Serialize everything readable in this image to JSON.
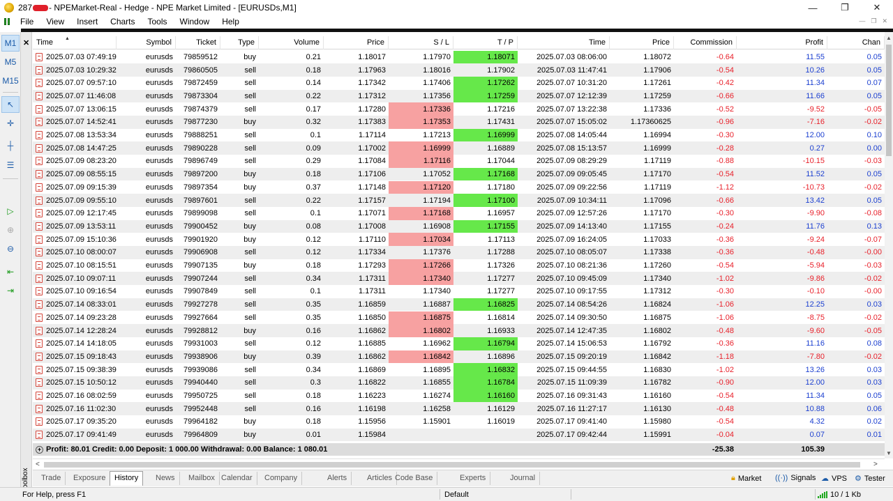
{
  "window": {
    "title_prefix": "287",
    "title_rest": "- NPEMarket-Real - Hedge - NPE Market Limited - [EURUSDs,M1]",
    "minimize": "—",
    "restore": "❐",
    "close": "✕"
  },
  "menu": [
    "File",
    "View",
    "Insert",
    "Charts",
    "Tools",
    "Window",
    "Help"
  ],
  "timeframes": [
    "M1",
    "M5",
    "M15"
  ],
  "toolbox_label": "Toolbox",
  "columns": [
    "Time",
    "Symbol",
    "Ticket",
    "Type",
    "Volume",
    "Price",
    "S / L",
    "T / P",
    "Time",
    "Price",
    "Commission",
    "Profit",
    "Chan"
  ],
  "rows": [
    [
      "2025.07.03 07:49:19",
      "eurusds",
      "79859512",
      "buy",
      "0.21",
      "1.18017",
      "1.17970",
      "1.18071",
      "2025.07.03 08:06:00",
      "1.18072",
      "-0.64",
      "11.55",
      "0.05",
      "tp"
    ],
    [
      "2025.07.03 10:29:32",
      "eurusds",
      "79860505",
      "sell",
      "0.18",
      "1.17963",
      "1.18016",
      "1.17902",
      "2025.07.03 11:47:41",
      "1.17906",
      "-0.54",
      "10.26",
      "0.05",
      ""
    ],
    [
      "2025.07.07 09:57:10",
      "eurusds",
      "79872459",
      "sell",
      "0.14",
      "1.17342",
      "1.17406",
      "1.17262",
      "2025.07.07 10:31:20",
      "1.17261",
      "-0.42",
      "11.34",
      "0.07",
      "tp"
    ],
    [
      "2025.07.07 11:46:08",
      "eurusds",
      "79873304",
      "sell",
      "0.22",
      "1.17312",
      "1.17356",
      "1.17259",
      "2025.07.07 12:12:39",
      "1.17259",
      "-0.66",
      "11.66",
      "0.05",
      "tp"
    ],
    [
      "2025.07.07 13:06:15",
      "eurusds",
      "79874379",
      "sell",
      "0.17",
      "1.17280",
      "1.17336",
      "1.17216",
      "2025.07.07 13:22:38",
      "1.17336",
      "-0.52",
      "-9.52",
      "-0.05",
      "sl"
    ],
    [
      "2025.07.07 14:52:41",
      "eurusds",
      "79877230",
      "buy",
      "0.32",
      "1.17383",
      "1.17353",
      "1.17431",
      "2025.07.07 15:05:02",
      "1.17360625",
      "-0.96",
      "-7.16",
      "-0.02",
      "sl"
    ],
    [
      "2025.07.08 13:53:34",
      "eurusds",
      "79888251",
      "sell",
      "0.1",
      "1.17114",
      "1.17213",
      "1.16999",
      "2025.07.08 14:05:44",
      "1.16994",
      "-0.30",
      "12.00",
      "0.10",
      "tp"
    ],
    [
      "2025.07.08 14:47:25",
      "eurusds",
      "79890228",
      "sell",
      "0.09",
      "1.17002",
      "1.16999",
      "1.16889",
      "2025.07.08 15:13:57",
      "1.16999",
      "-0.28",
      "0.27",
      "0.00",
      "sl"
    ],
    [
      "2025.07.09 08:23:20",
      "eurusds",
      "79896749",
      "sell",
      "0.29",
      "1.17084",
      "1.17116",
      "1.17044",
      "2025.07.09 08:29:29",
      "1.17119",
      "-0.88",
      "-10.15",
      "-0.03",
      "sl"
    ],
    [
      "2025.07.09 08:55:15",
      "eurusds",
      "79897200",
      "buy",
      "0.18",
      "1.17106",
      "1.17052",
      "1.17168",
      "2025.07.09 09:05:45",
      "1.17170",
      "-0.54",
      "11.52",
      "0.05",
      "tp"
    ],
    [
      "2025.07.09 09:15:39",
      "eurusds",
      "79897354",
      "buy",
      "0.37",
      "1.17148",
      "1.17120",
      "1.17180",
      "2025.07.09 09:22:56",
      "1.17119",
      "-1.12",
      "-10.73",
      "-0.02",
      "sl"
    ],
    [
      "2025.07.09 09:55:10",
      "eurusds",
      "79897601",
      "sell",
      "0.22",
      "1.17157",
      "1.17194",
      "1.17100",
      "2025.07.09 10:34:11",
      "1.17096",
      "-0.66",
      "13.42",
      "0.05",
      "tp"
    ],
    [
      "2025.07.09 12:17:45",
      "eurusds",
      "79899098",
      "sell",
      "0.1",
      "1.17071",
      "1.17168",
      "1.16957",
      "2025.07.09 12:57:26",
      "1.17170",
      "-0.30",
      "-9.90",
      "-0.08",
      "sl"
    ],
    [
      "2025.07.09 13:53:11",
      "eurusds",
      "79900452",
      "buy",
      "0.08",
      "1.17008",
      "1.16908",
      "1.17155",
      "2025.07.09 14:13:40",
      "1.17155",
      "-0.24",
      "11.76",
      "0.13",
      "tp"
    ],
    [
      "2025.07.09 15:10:36",
      "eurusds",
      "79901920",
      "buy",
      "0.12",
      "1.17110",
      "1.17034",
      "1.17113",
      "2025.07.09 16:24:05",
      "1.17033",
      "-0.36",
      "-9.24",
      "-0.07",
      "sl"
    ],
    [
      "2025.07.10 08:00:07",
      "eurusds",
      "79906908",
      "sell",
      "0.12",
      "1.17334",
      "1.17376",
      "1.17288",
      "2025.07.10 08:05:07",
      "1.17338",
      "-0.36",
      "-0.48",
      "-0.00",
      ""
    ],
    [
      "2025.07.10 08:15:51",
      "eurusds",
      "79907135",
      "buy",
      "0.18",
      "1.17293",
      "1.17266",
      "1.17326",
      "2025.07.10 08:21:36",
      "1.17260",
      "-0.54",
      "-5.94",
      "-0.03",
      "sl"
    ],
    [
      "2025.07.10 09:07:11",
      "eurusds",
      "79907244",
      "sell",
      "0.34",
      "1.17311",
      "1.17340",
      "1.17277",
      "2025.07.10 09:45:09",
      "1.17340",
      "-1.02",
      "-9.86",
      "-0.02",
      "sl"
    ],
    [
      "2025.07.10 09:16:54",
      "eurusds",
      "79907849",
      "sell",
      "0.1",
      "1.17311",
      "1.17340",
      "1.17277",
      "2025.07.10 09:17:55",
      "1.17312",
      "-0.30",
      "-0.10",
      "-0.00",
      ""
    ],
    [
      "2025.07.14 08:33:01",
      "eurusds",
      "79927278",
      "sell",
      "0.35",
      "1.16859",
      "1.16887",
      "1.16825",
      "2025.07.14 08:54:26",
      "1.16824",
      "-1.06",
      "12.25",
      "0.03",
      "tp"
    ],
    [
      "2025.07.14 09:23:28",
      "eurusds",
      "79927664",
      "sell",
      "0.35",
      "1.16850",
      "1.16875",
      "1.16814",
      "2025.07.14 09:30:50",
      "1.16875",
      "-1.06",
      "-8.75",
      "-0.02",
      "sl"
    ],
    [
      "2025.07.14 12:28:24",
      "eurusds",
      "79928812",
      "buy",
      "0.16",
      "1.16862",
      "1.16802",
      "1.16933",
      "2025.07.14 12:47:35",
      "1.16802",
      "-0.48",
      "-9.60",
      "-0.05",
      "sl"
    ],
    [
      "2025.07.14 14:18:05",
      "eurusds",
      "79931003",
      "sell",
      "0.12",
      "1.16885",
      "1.16962",
      "1.16794",
      "2025.07.14 15:06:53",
      "1.16792",
      "-0.36",
      "11.16",
      "0.08",
      "tp"
    ],
    [
      "2025.07.15 09:18:43",
      "eurusds",
      "79938906",
      "buy",
      "0.39",
      "1.16862",
      "1.16842",
      "1.16896",
      "2025.07.15 09:20:19",
      "1.16842",
      "-1.18",
      "-7.80",
      "-0.02",
      "sl"
    ],
    [
      "2025.07.15 09:38:39",
      "eurusds",
      "79939086",
      "sell",
      "0.34",
      "1.16869",
      "1.16895",
      "1.16832",
      "2025.07.15 09:44:55",
      "1.16830",
      "-1.02",
      "13.26",
      "0.03",
      "tp"
    ],
    [
      "2025.07.15 10:50:12",
      "eurusds",
      "79940440",
      "sell",
      "0.3",
      "1.16822",
      "1.16855",
      "1.16784",
      "2025.07.15 11:09:39",
      "1.16782",
      "-0.90",
      "12.00",
      "0.03",
      "tp"
    ],
    [
      "2025.07.16 08:02:59",
      "eurusds",
      "79950725",
      "sell",
      "0.18",
      "1.16223",
      "1.16274",
      "1.16160",
      "2025.07.16 09:31:43",
      "1.16160",
      "-0.54",
      "11.34",
      "0.05",
      "tp"
    ],
    [
      "2025.07.16 11:02:30",
      "eurusds",
      "79952448",
      "sell",
      "0.16",
      "1.16198",
      "1.16258",
      "1.16129",
      "2025.07.16 11:27:17",
      "1.16130",
      "-0.48",
      "10.88",
      "0.06",
      ""
    ],
    [
      "2025.07.17 09:35:20",
      "eurusds",
      "79964182",
      "buy",
      "0.18",
      "1.15956",
      "1.15901",
      "1.16019",
      "2025.07.17 09:41:40",
      "1.15980",
      "-0.54",
      "4.32",
      "0.02",
      ""
    ],
    [
      "2025.07.17 09:41:49",
      "eurusds",
      "79964809",
      "buy",
      "0.01",
      "1.15984",
      "",
      "",
      "2025.07.17 09:42:44",
      "1.15991",
      "-0.04",
      "0.07",
      "0.01",
      ""
    ]
  ],
  "summary": {
    "text": "Profit: 80.01  Credit: 0.00  Deposit: 1 000.00  Withdrawal: 0.00  Balance: 1 080.01",
    "commission": "-25.38",
    "profit": "105.39"
  },
  "tabs": [
    "Trade",
    "Exposure",
    "History",
    "News",
    "Mailbox",
    "Calendar",
    "Company",
    "Alerts",
    "Articles",
    "Code Base",
    "Experts",
    "Journal"
  ],
  "active_tab": "History",
  "right_tabs": [
    {
      "icon": "market-icon",
      "label": "Market"
    },
    {
      "icon": "signals-icon",
      "label": "Signals"
    },
    {
      "icon": "vps-icon",
      "label": "VPS"
    },
    {
      "icon": "tester-icon",
      "label": "Tester"
    }
  ],
  "status": {
    "help": "For Help, press F1",
    "profile": "Default",
    "traffic": "10 / 1 Kb"
  },
  "colors": {
    "sl_hit": "#f7a1a1",
    "tp_hit": "#66e84a",
    "negative": "#e8202a",
    "positive": "#1b3fd0"
  }
}
